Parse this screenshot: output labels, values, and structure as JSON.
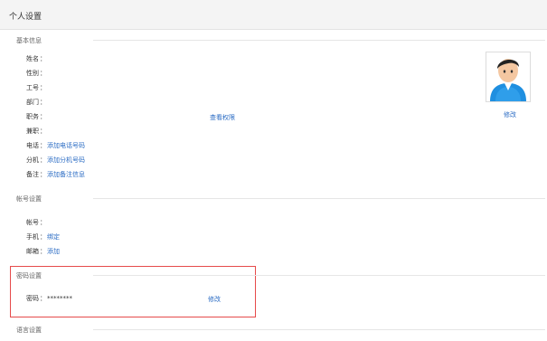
{
  "header": {
    "title": "个人设置"
  },
  "basic": {
    "heading": "基本信息",
    "perm_link": "查看权限",
    "fields": [
      {
        "label": "姓名",
        "value": ""
      },
      {
        "label": "性别",
        "value": ""
      },
      {
        "label": "工号",
        "value": ""
      },
      {
        "label": "部门",
        "value": ""
      },
      {
        "label": "职务",
        "value": ""
      },
      {
        "label": "兼职",
        "value": ""
      },
      {
        "label": "电话",
        "value": "添加电话号码"
      },
      {
        "label": "分机",
        "value": "添加分机号码"
      },
      {
        "label": "备注",
        "value": "添加备注信息"
      }
    ],
    "avatar_edit": "修改"
  },
  "account": {
    "heading": "帐号设置",
    "fields": [
      {
        "label": "帐号",
        "value": ""
      },
      {
        "label": "手机",
        "value": "绑定"
      },
      {
        "label": "邮箱",
        "value": "添加"
      }
    ]
  },
  "password": {
    "heading": "密码设置",
    "label": "密码",
    "value": "********",
    "edit": "修改"
  },
  "language": {
    "heading": "语言设置"
  },
  "colors": {
    "accent": "#2b6cc4",
    "highlight": "#e64b4b"
  }
}
